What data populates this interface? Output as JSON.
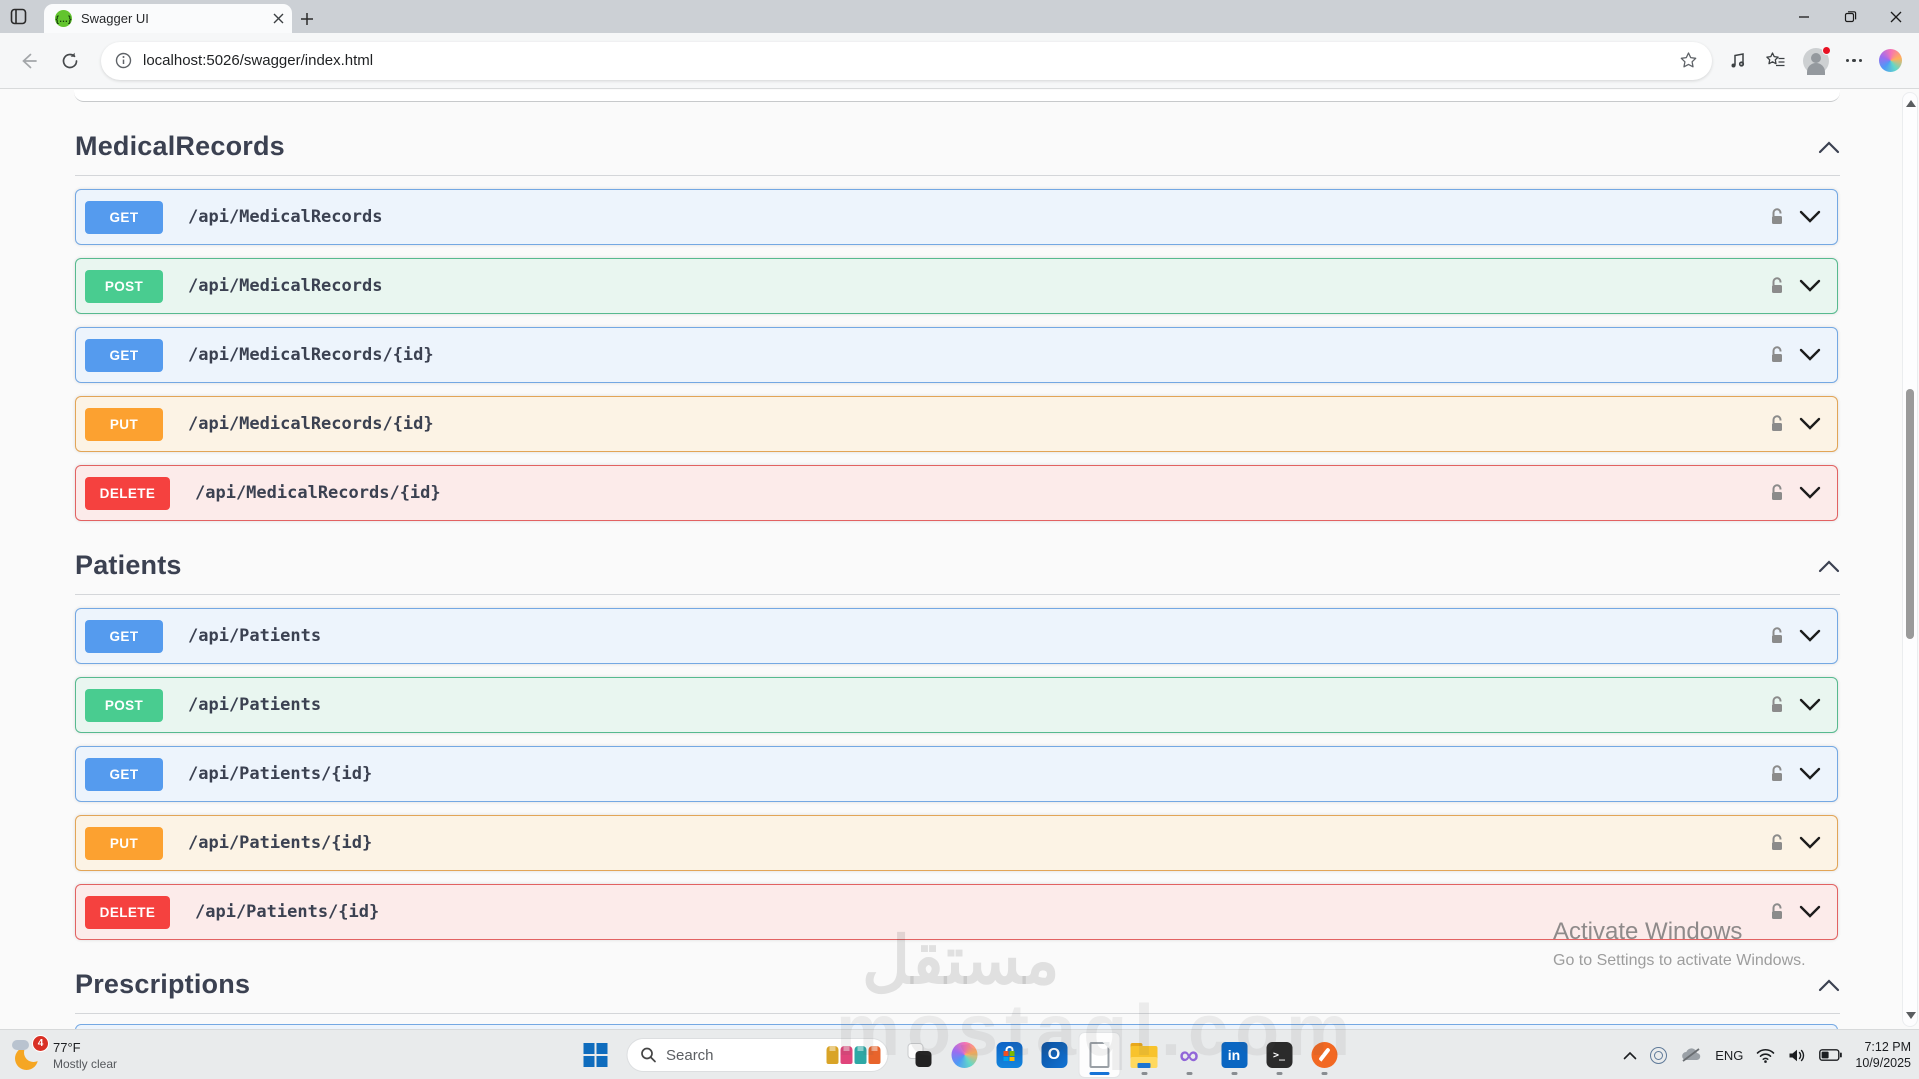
{
  "browser": {
    "tab_title": "Swagger UI",
    "url": "localhost:5026/swagger/index.html"
  },
  "page": {
    "sections": [
      {
        "name": "MedicalRecords",
        "endpoints": [
          {
            "method": "GET",
            "path": "/api/MedicalRecords"
          },
          {
            "method": "POST",
            "path": "/api/MedicalRecords"
          },
          {
            "method": "GET",
            "path": "/api/MedicalRecords/{id}"
          },
          {
            "method": "PUT",
            "path": "/api/MedicalRecords/{id}"
          },
          {
            "method": "DELETE",
            "path": "/api/MedicalRecords/{id}"
          }
        ]
      },
      {
        "name": "Patients",
        "endpoints": [
          {
            "method": "GET",
            "path": "/api/Patients"
          },
          {
            "method": "POST",
            "path": "/api/Patients"
          },
          {
            "method": "GET",
            "path": "/api/Patients/{id}"
          },
          {
            "method": "PUT",
            "path": "/api/Patients/{id}"
          },
          {
            "method": "DELETE",
            "path": "/api/Patients/{id}"
          }
        ]
      },
      {
        "name": "Prescriptions",
        "endpoints": []
      }
    ],
    "watermark": {
      "arabic": "مستقل",
      "latin": "mostaql.com"
    },
    "activation": {
      "title": "Activate Windows",
      "subtitle": "Go to Settings to activate Windows."
    }
  },
  "taskbar": {
    "weather": {
      "badge": "4",
      "temperature": "77°F",
      "condition": "Mostly clear"
    },
    "search_placeholder": "Search",
    "tray": {
      "language": "ENG",
      "time": "7:12 PM",
      "date": "10/9/2025"
    }
  },
  "colors": {
    "get": "#559bee",
    "post": "#49cc90",
    "put": "#fca130",
    "delete": "#f5413f",
    "swagger_green": "#62c42e",
    "accent_blue": "#1573d6",
    "heading_text": "#3b4151"
  }
}
